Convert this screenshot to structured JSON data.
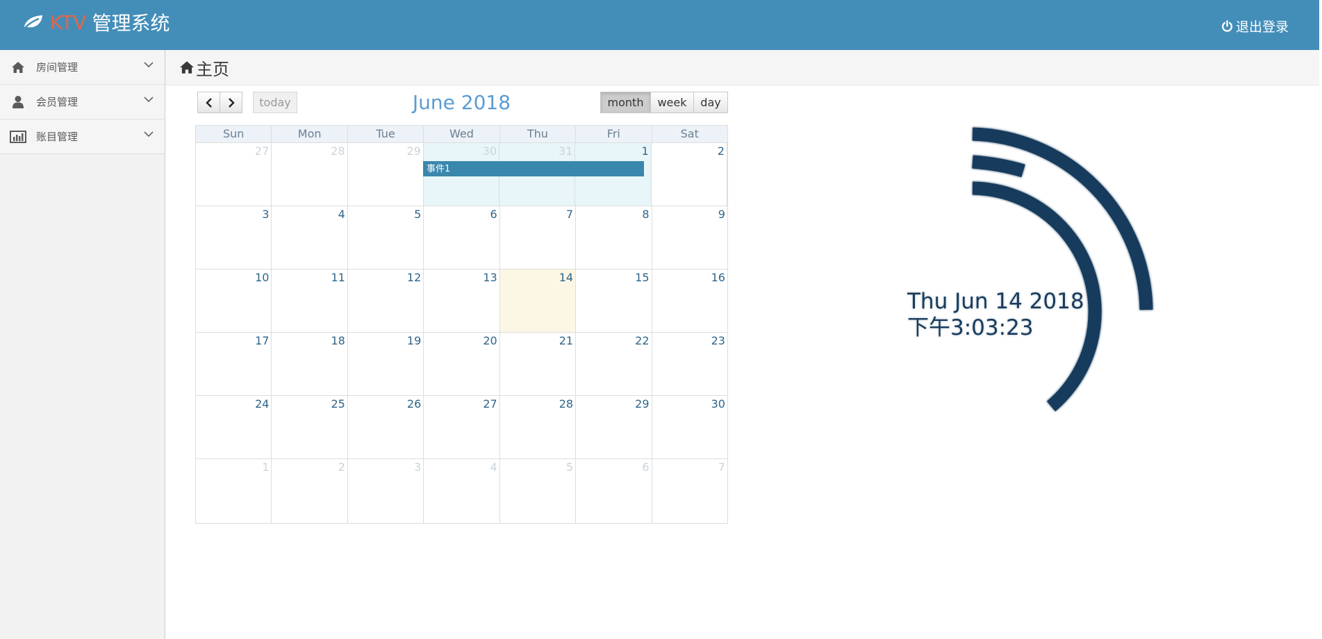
{
  "header": {
    "brand_accent": "KTV",
    "brand_title": "管理系统",
    "logout_label": "退出登录",
    "colors": {
      "bar": "#438eb9",
      "accent": "#e2664c"
    }
  },
  "sidebar": {
    "items": [
      {
        "label": "房间管理",
        "icon": "home-icon"
      },
      {
        "label": "会员管理",
        "icon": "user-icon"
      },
      {
        "label": "账目管理",
        "icon": "bar-chart-icon"
      }
    ]
  },
  "breadcrumb": {
    "label": "主页"
  },
  "calendar": {
    "title": "June 2018",
    "today_label": "today",
    "views": {
      "month": "month",
      "week": "week",
      "day": "day",
      "active": "month"
    },
    "dow": [
      "Sun",
      "Mon",
      "Tue",
      "Wed",
      "Thu",
      "Fri",
      "Sat"
    ],
    "weeks": [
      [
        "27",
        "28",
        "29",
        "30",
        "31",
        "1",
        "2"
      ],
      [
        "3",
        "4",
        "5",
        "6",
        "7",
        "8",
        "9"
      ],
      [
        "10",
        "11",
        "12",
        "13",
        "14",
        "15",
        "16"
      ],
      [
        "17",
        "18",
        "19",
        "20",
        "21",
        "22",
        "23"
      ],
      [
        "24",
        "25",
        "26",
        "27",
        "28",
        "29",
        "30"
      ],
      [
        "1",
        "2",
        "3",
        "4",
        "5",
        "6",
        "7"
      ]
    ],
    "today": "14",
    "event": {
      "title": "事件1",
      "start": "2018-05-30",
      "end": "2018-06-01"
    }
  },
  "clock": {
    "date": "Thu Jun 14 2018",
    "time": "下午3:03:23",
    "color": "#183b5c"
  }
}
